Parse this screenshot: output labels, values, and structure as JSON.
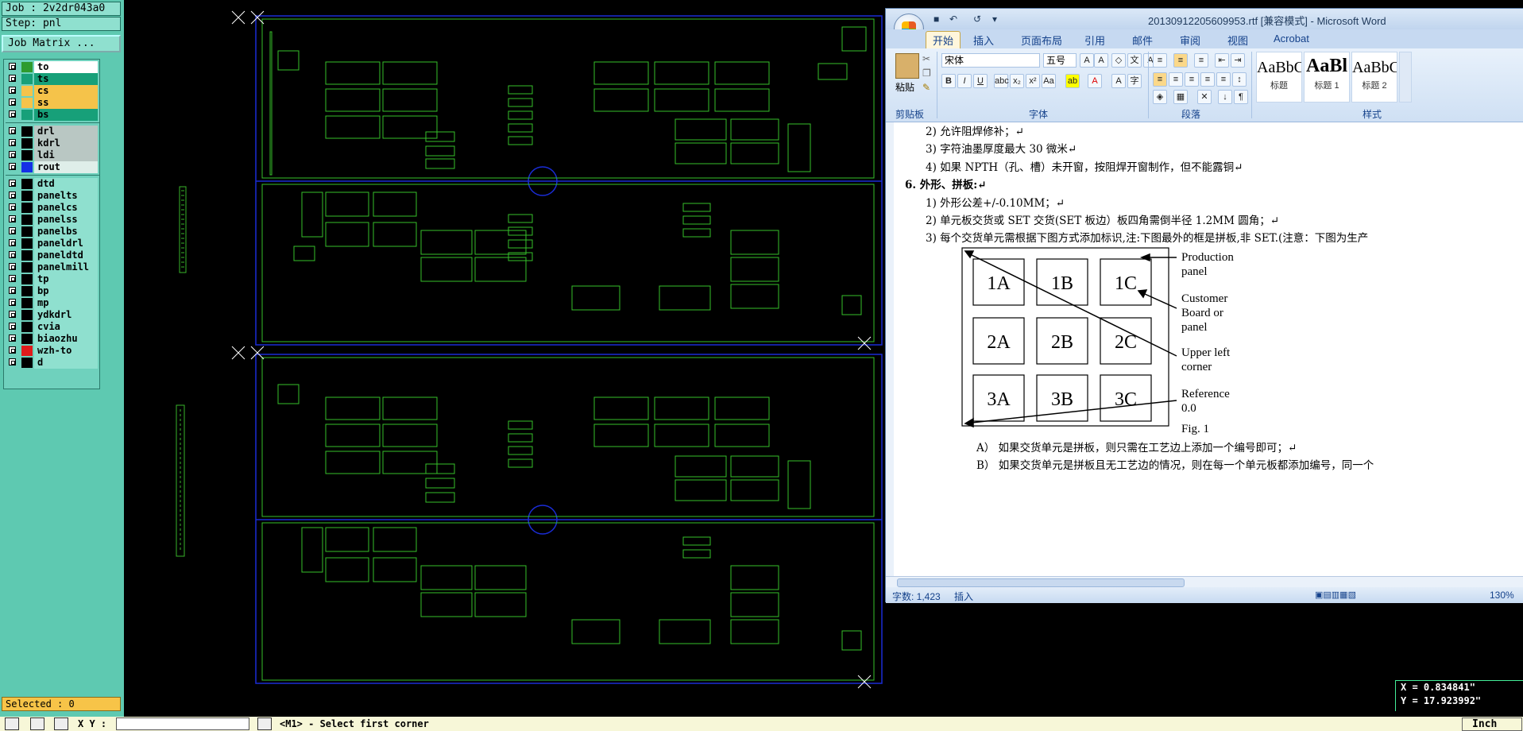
{
  "genesis": {
    "job_label": "Job : 2v2dr043a0",
    "step_label": "Step: pnl",
    "job_matrix_button": "Job Matrix ...",
    "layers": [
      {
        "name": "to",
        "color": "#2e9b2e"
      },
      {
        "name": "ts",
        "color": "#17a079"
      },
      {
        "name": "cs",
        "color": "#f5c34a"
      },
      {
        "name": "ss",
        "color": "#f5c34a"
      },
      {
        "name": "bs",
        "color": "#17a079"
      },
      {
        "name": "drl",
        "color": "#000000"
      },
      {
        "name": "kdrl",
        "color": "#000000"
      },
      {
        "name": "ldi",
        "color": "#000000"
      },
      {
        "name": "rout",
        "color": "#1530e6"
      },
      {
        "name": "dtd",
        "color": "#000000"
      },
      {
        "name": "panelts",
        "color": "#000000"
      },
      {
        "name": "panelcs",
        "color": "#000000"
      },
      {
        "name": "panelss",
        "color": "#000000"
      },
      {
        "name": "panelbs",
        "color": "#000000"
      },
      {
        "name": "paneldrl",
        "color": "#000000"
      },
      {
        "name": "paneldtd",
        "color": "#000000"
      },
      {
        "name": "panelmill",
        "color": "#000000"
      },
      {
        "name": "tp",
        "color": "#000000"
      },
      {
        "name": "bp",
        "color": "#000000"
      },
      {
        "name": "mp",
        "color": "#000000"
      },
      {
        "name": "ydkdrl",
        "color": "#000000"
      },
      {
        "name": "cvia",
        "color": "#000000"
      },
      {
        "name": "biaozhu",
        "color": "#000000"
      },
      {
        "name": "wzh-to",
        "color": "#e11b1b"
      },
      {
        "name": "d",
        "color": "#000000"
      }
    ],
    "selected_label": "Selected : 0",
    "xy_label": "X Y :",
    "status_message": "<M1> - Select first corner",
    "unit_button": "Inch",
    "coord_x": "X =  0.834841\"",
    "coord_y": "Y = 17.923992\""
  },
  "word": {
    "title": "20130912205609953.rtf [兼容模式] - Microsoft Word",
    "tabs": [
      "开始",
      "插入",
      "页面布局",
      "引用",
      "邮件",
      "审阅",
      "视图",
      "Acrobat"
    ],
    "font_name": "宋体",
    "font_size": "五号",
    "paste_label": "粘贴",
    "groups": [
      "剪贴板",
      "字体",
      "段落",
      "样式"
    ],
    "styles": [
      {
        "sample": "AaBbC",
        "name": "标题"
      },
      {
        "sample": "AaBl",
        "name": "标题 1"
      },
      {
        "sample": "AaBbC",
        "name": "标题 2"
      }
    ],
    "doc_lines": [
      "2)  允许阻焊修补；↵",
      "3)  字符油墨厚度最大 30 微米↵",
      "4)  如果 NPTH（孔、槽）未开窗，按阻焊开窗制作，但不能露铜↵",
      "6.  外形、拼板:↵",
      "1)  外形公差+/-0.10MM；↵",
      "2)  单元板交货或 SET 交货(SET 板边）板四角需倒半径 1.2MM 圆角；↵",
      "3)  每个交货单元需根据下图方式添加标识,注:下图最外的框是拼板,非 SET.(注意：下图为生产"
    ],
    "figure": {
      "cells": [
        "1A",
        "1B",
        "1C",
        "2A",
        "2B",
        "2C",
        "3A",
        "3B",
        "3C"
      ],
      "label_production": "Production\npanel",
      "label_customer": "Customer\nBoard or\npanel",
      "label_upper": "Upper left\ncorner",
      "label_reference": "Reference\n0.0",
      "caption": "Fig. 1"
    },
    "doc_lines_after": [
      "A）  如果交货单元是拼板，则只需在工艺边上添加一个编号即可；↵",
      "B）  如果交货单元是拼板且无工艺边的情况，则在每一个单元板都添加编号，同一个"
    ],
    "word_count": "字数: 1,423",
    "insert_mode": "插入",
    "zoom": "130%"
  }
}
